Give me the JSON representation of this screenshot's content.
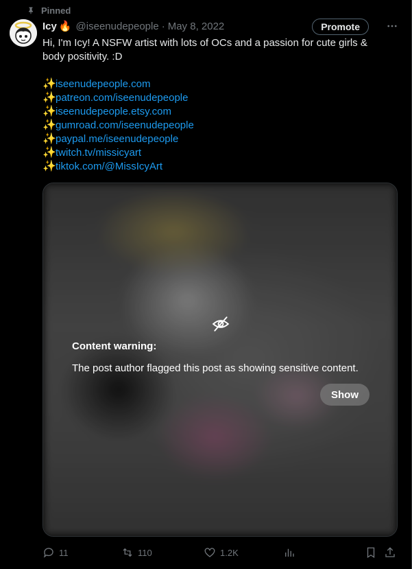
{
  "pinned": {
    "label": "Pinned"
  },
  "tweet": {
    "name": "Icy",
    "name_emoji": "🔥",
    "handle": "@iseenudepeople",
    "separator": "·",
    "date": "May 8, 2022",
    "promote_label": "Promote",
    "bio_line1": "Hi, I'm Icy! A NSFW artist with lots of OCs and a passion for cute girls &",
    "bio_line2": "body positivity. :D",
    "links": [
      {
        "emoji": "✨",
        "url": "iseenudepeople.com"
      },
      {
        "emoji": "✨",
        "url": "patreon.com/iseenudepeople"
      },
      {
        "emoji": "✨",
        "url": "iseenudepeople.etsy.com"
      },
      {
        "emoji": "✨",
        "url": "gumroad.com/iseenudepeople"
      },
      {
        "emoji": "✨",
        "url": "paypal.me/iseenudepeople"
      },
      {
        "emoji": "✨",
        "url": "twitch.tv/missicyart"
      },
      {
        "emoji": "✨",
        "url": "tiktok.com/@MissIcyArt"
      }
    ]
  },
  "media": {
    "warning_title": "Content warning:",
    "warning_text": "The post author flagged this post as showing sensitive content.",
    "show_label": "Show",
    "icon": "eye-off-icon"
  },
  "actions": {
    "replies": "11",
    "reposts": "110",
    "likes": "1.2K"
  },
  "colors": {
    "background": "#000000",
    "text": "#e7e9ea",
    "muted": "#71767b",
    "link": "#1d9bf0"
  }
}
